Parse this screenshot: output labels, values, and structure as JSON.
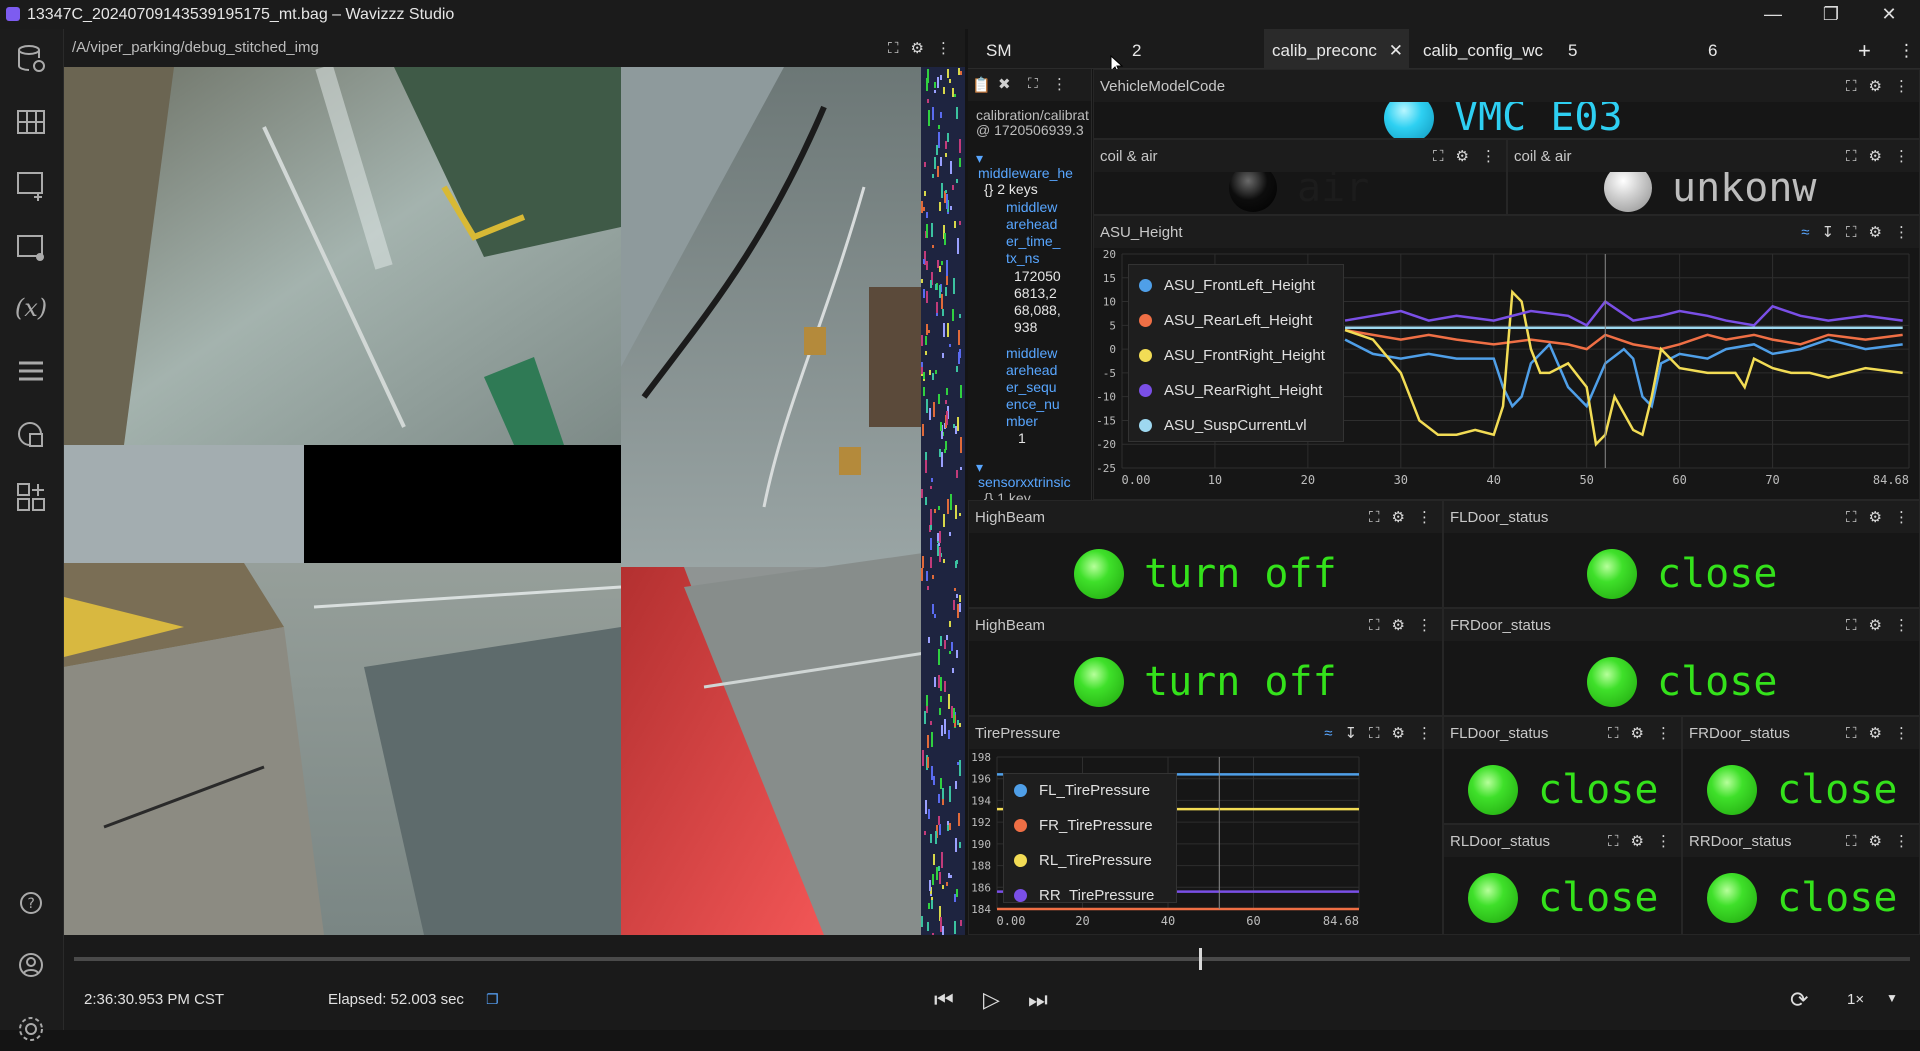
{
  "window": {
    "title": "13347C_20240709143539195175_mt.bag – Wavizzz Studio",
    "controls": [
      "minimize",
      "restore",
      "close"
    ]
  },
  "rail": {
    "icons": [
      "data-source-icon",
      "layout-grid-icon",
      "add-panel-icon",
      "panel-settings-icon",
      "variables-icon",
      "extensions-list-icon",
      "studio-logs-icon",
      "add-layout-icon"
    ],
    "bottom_icons": [
      "help-icon",
      "account-icon",
      "settings-icon"
    ],
    "variables_glyph": "(x)"
  },
  "image_panel": {
    "topic": "/A/viper_parking/debug_stitched_img"
  },
  "tabs": [
    {
      "label": "SM",
      "active": false
    },
    {
      "label": "2",
      "active": false
    },
    {
      "label": "calib_preconc",
      "active": true
    },
    {
      "label": "calib_config_wc",
      "active": false
    },
    {
      "label": "5",
      "active": false
    },
    {
      "label": "6",
      "active": false
    }
  ],
  "raw_message": {
    "lines": [
      "calibration/calibrat",
      "@ 1720506939.3",
      "middleware_he",
      "{} 2 keys",
      "middlew",
      "arehead",
      "er_time_",
      "tx_ns",
      "172050",
      "6813,2",
      "68,088,",
      "938",
      "middlew",
      "arehead",
      "er_sequ",
      "ence_nu",
      "mber",
      "1",
      "sensorxxtrinsic",
      "{} 1 key"
    ]
  },
  "panels": {
    "vmc": {
      "title": "VehicleModelCode",
      "value": "VMC E03",
      "color": "#2ecff2"
    },
    "coil_air_1": {
      "title": "coil & air",
      "value": "air"
    },
    "coil_air_2": {
      "title": "coil & air",
      "value": "unkonw"
    },
    "asu_height": {
      "title": "ASU_Height"
    },
    "highbeam_1": {
      "title": "HighBeam",
      "value": "turn off"
    },
    "fldoor_1": {
      "title": "FLDoor_status",
      "value": "close"
    },
    "highbeam_2": {
      "title": "HighBeam",
      "value": "turn off"
    },
    "frdoor_1": {
      "title": "FRDoor_status",
      "value": "close"
    },
    "tire_pressure": {
      "title": "TirePressure"
    },
    "fldoor_2": {
      "title": "FLDoor_status",
      "value": "close"
    },
    "frdoor_2": {
      "title": "FRDoor_status",
      "value": "close"
    },
    "rldoor": {
      "title": "RLDoor_status",
      "value": "close"
    },
    "rrdoor": {
      "title": "RRDoor_status",
      "value": "close"
    }
  },
  "playback": {
    "time": "2:36:30.953 PM CST",
    "elapsed": "Elapsed: 52.003 sec",
    "speed": "1×",
    "progress": 0.613
  },
  "chart_data": [
    {
      "type": "line",
      "title": "ASU_Height",
      "ylim": [
        -25,
        20
      ],
      "xlim": [
        0,
        84.68
      ],
      "yticks": [
        "20",
        "15",
        "10",
        "5",
        "0",
        "-5",
        "-10",
        "-15",
        "-20",
        "-25"
      ],
      "xticks": [
        "0.00",
        "10",
        "20",
        "30",
        "40",
        "50",
        "60",
        "70",
        "84.68"
      ],
      "cursor_x": 52,
      "series": [
        {
          "name": "ASU_FrontLeft_Height",
          "color": "#4f9fe8",
          "x": [
            24,
            27,
            30,
            33,
            36,
            40,
            41,
            42,
            43,
            44,
            46,
            48,
            50,
            52,
            54,
            55,
            56,
            57,
            58,
            60,
            63,
            65,
            68,
            70,
            73,
            76,
            80,
            84
          ],
          "y": [
            2,
            -1,
            -2,
            -1,
            -2,
            -2,
            -8,
            -12,
            -10,
            -3,
            1,
            -8,
            -12,
            -3,
            0,
            -2,
            -10,
            -12,
            -3,
            -1,
            -2,
            0,
            1,
            -1,
            0,
            2,
            0,
            1
          ]
        },
        {
          "name": "ASU_RearLeft_Height",
          "color": "#ef6f45",
          "x": [
            24,
            27,
            30,
            33,
            36,
            40,
            44,
            48,
            50,
            52,
            55,
            58,
            60,
            63,
            65,
            68,
            70,
            73,
            76,
            80,
            84
          ],
          "y": [
            4,
            3,
            2,
            3,
            2,
            1,
            2,
            1,
            0,
            3,
            1,
            0,
            1,
            3,
            2,
            3,
            2,
            1,
            3,
            2,
            3
          ]
        },
        {
          "name": "ASU_FrontRight_Height",
          "color": "#f2dc55",
          "x": [
            24,
            27,
            30,
            32,
            34,
            36,
            38,
            40,
            41,
            42,
            43,
            44,
            45,
            46,
            48,
            50,
            51,
            52,
            53,
            55,
            56,
            57,
            58,
            59,
            60,
            63,
            66,
            67,
            68,
            70,
            72,
            74,
            76,
            80,
            84
          ],
          "y": [
            4,
            2,
            -5,
            -15,
            -18,
            -18,
            -17,
            -18,
            -12,
            12,
            10,
            0,
            -5,
            -5,
            -3,
            -8,
            -20,
            -18,
            -10,
            -17,
            -18,
            -10,
            0,
            -2,
            -4,
            -5,
            -5,
            -8,
            -2,
            -4,
            -5,
            -5,
            -6,
            -4,
            -5
          ]
        },
        {
          "name": "ASU_RearRight_Height",
          "color": "#7a4fe6",
          "x": [
            24,
            27,
            30,
            33,
            36,
            40,
            44,
            48,
            50,
            52,
            55,
            58,
            60,
            63,
            65,
            68,
            70,
            73,
            76,
            80,
            84
          ],
          "y": [
            6,
            7,
            8,
            6,
            7,
            6,
            8,
            7,
            5,
            10,
            6,
            7,
            8,
            7,
            6,
            5,
            9,
            7,
            6,
            7,
            6
          ]
        },
        {
          "name": "ASU_SuspCurrentLvl",
          "color": "#9ed8f0",
          "x": [
            24,
            84
          ],
          "y": [
            4.5,
            4.5
          ]
        }
      ]
    },
    {
      "type": "line",
      "title": "TirePressure",
      "ylim": [
        184,
        198
      ],
      "xlim": [
        0,
        84.68
      ],
      "yticks": [
        "198",
        "196",
        "194",
        "192",
        "190",
        "188",
        "186",
        "184"
      ],
      "xticks": [
        "0.00",
        "20",
        "40",
        "60",
        "84.68"
      ],
      "cursor_x": 52,
      "series": [
        {
          "name": "FL_TirePressure",
          "color": "#4f9fe8",
          "x": [
            0,
            84.68
          ],
          "y": [
            196.4,
            196.4
          ]
        },
        {
          "name": "FR_TirePressure",
          "color": "#ef6f45",
          "x": [
            0,
            84.68
          ],
          "y": [
            184.0,
            184.0
          ]
        },
        {
          "name": "RL_TirePressure",
          "color": "#f2dc55",
          "x": [
            0,
            84.68
          ],
          "y": [
            193.2,
            193.2
          ]
        },
        {
          "name": "RR_TirePressure",
          "color": "#7a4fe6",
          "x": [
            0,
            84.68
          ],
          "y": [
            185.6,
            185.6
          ]
        }
      ]
    }
  ]
}
